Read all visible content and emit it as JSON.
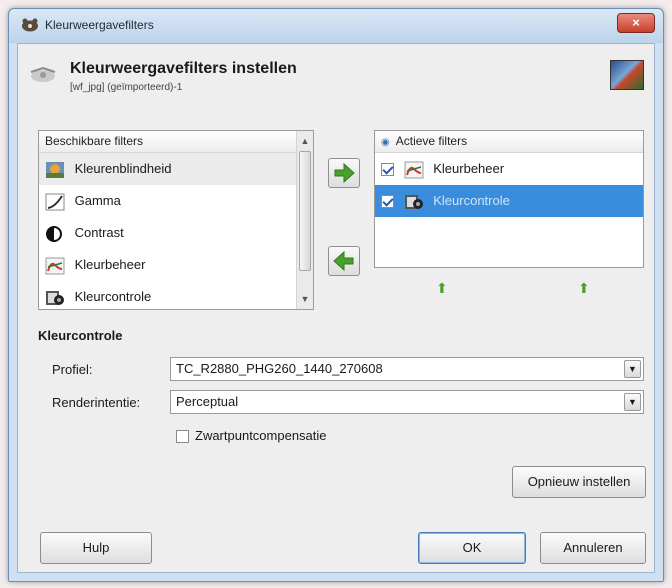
{
  "window": {
    "title": "Kleurweergavefilters",
    "close_glyph": "×"
  },
  "header": {
    "title": "Kleurweergavefilters instellen",
    "subtitle": "[wf_jpg] (geïmporteerd)-1"
  },
  "available": {
    "header": "Beschikbare filters",
    "items": [
      {
        "label": "Kleurenblindheid",
        "icon": "color-blindness-icon"
      },
      {
        "label": "Gamma",
        "icon": "gamma-icon"
      },
      {
        "label": "Contrast",
        "icon": "contrast-icon"
      },
      {
        "label": "Kleurbeheer",
        "icon": "color-management-icon"
      },
      {
        "label": "Kleurcontrole",
        "icon": "proof-icon"
      }
    ]
  },
  "active": {
    "header": "Actieve filters",
    "items": [
      {
        "label": "Kleurbeheer",
        "checked": true,
        "icon": "color-management-icon"
      },
      {
        "label": "Kleurcontrole",
        "checked": true,
        "selected": true,
        "icon": "proof-icon"
      }
    ]
  },
  "config": {
    "section_title": "Kleurcontrole",
    "profile_label": "Profiel:",
    "profile_value": "TC_R2880_PHG260_1440_270608",
    "intent_label": "Renderintentie:",
    "intent_value": "Perceptual",
    "bpc_label": "Zwartpuntcompensatie",
    "bpc_checked": false,
    "reset_label": "Opnieuw instellen"
  },
  "buttons": {
    "help": "Hulp",
    "ok": "OK",
    "cancel": "Annuleren"
  },
  "colors": {
    "selection": "#3a8ddc",
    "title_bar": "#cfe0f2",
    "arrow_green": "#4aa02c"
  }
}
